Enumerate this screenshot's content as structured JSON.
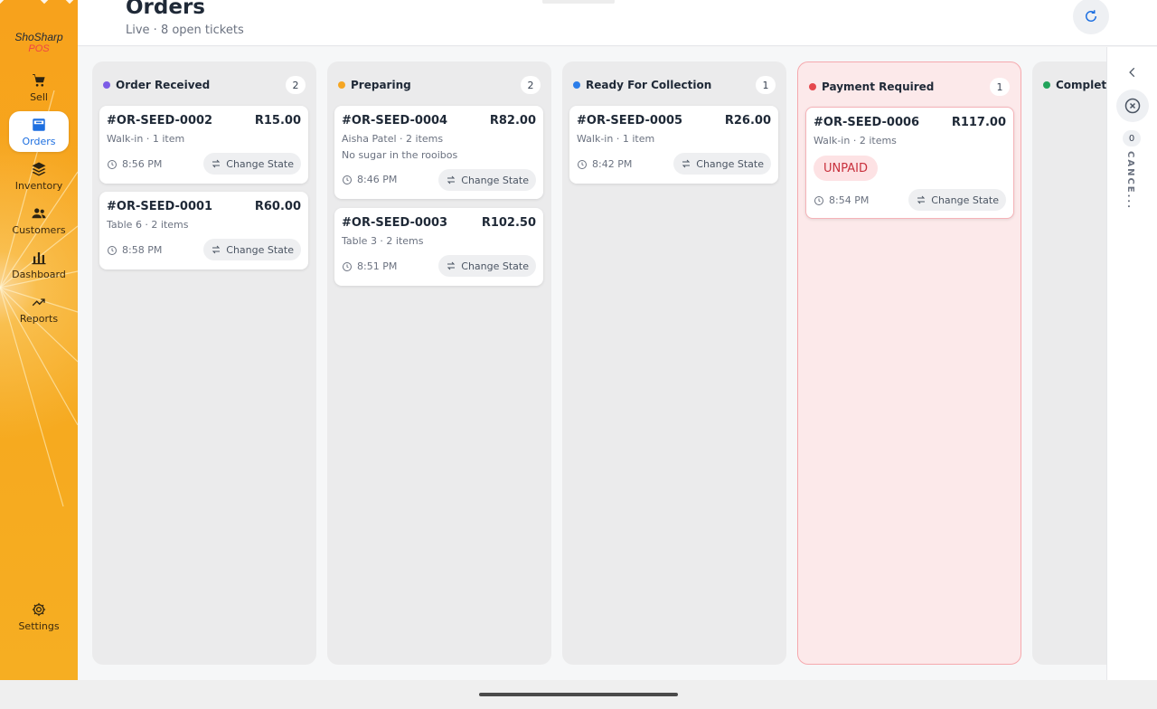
{
  "app": {
    "brand_name": "ShoSharp",
    "brand_sub": "POS"
  },
  "sidebar": {
    "items": [
      {
        "label": "Sell",
        "icon": "cart-icon"
      },
      {
        "label": "Orders",
        "icon": "orders-icon",
        "active": true
      },
      {
        "label": "Inventory",
        "icon": "layers-icon"
      },
      {
        "label": "Customers",
        "icon": "users-icon"
      },
      {
        "label": "Dashboard",
        "icon": "bar-chart-icon"
      },
      {
        "label": "Reports",
        "icon": "trend-icon"
      }
    ],
    "settings_label": "Settings"
  },
  "header": {
    "title": "Orders",
    "subtitle": "Live · 8 open tickets"
  },
  "board": {
    "change_state_label": "Change State",
    "columns": [
      {
        "title": "Order Received",
        "count": "2",
        "dot_color": "#7c5ce6",
        "cards": [
          {
            "id": "#OR-SEED-0002",
            "amount": "R15.00",
            "meta": "Walk-in · 1 item",
            "time": "8:56 PM"
          },
          {
            "id": "#OR-SEED-0001",
            "amount": "R60.00",
            "meta": "Table 6 · 2 items",
            "time": "8:58 PM"
          }
        ]
      },
      {
        "title": "Preparing",
        "count": "2",
        "dot_color": "#f5a623",
        "cards": [
          {
            "id": "#OR-SEED-0004",
            "amount": "R82.00",
            "meta": "Aisha Patel · 2 items",
            "note": "No sugar in the rooibos",
            "time": "8:46 PM"
          },
          {
            "id": "#OR-SEED-0003",
            "amount": "R102.50",
            "meta": "Table 3 · 2 items",
            "time": "8:51 PM"
          }
        ]
      },
      {
        "title": "Ready For Collection",
        "count": "1",
        "dot_color": "#2b7de9",
        "cards": [
          {
            "id": "#OR-SEED-0005",
            "amount": "R26.00",
            "meta": "Walk-in · 1 item",
            "time": "8:42 PM"
          }
        ]
      },
      {
        "title": "Payment Required",
        "count": "1",
        "dot_color": "#e5484d",
        "cards": [
          {
            "id": "#OR-SEED-0006",
            "amount": "R117.00",
            "meta": "Walk-in · 2 items",
            "badge": "UNPAID",
            "time": "8:54 PM"
          }
        ]
      },
      {
        "title": "Completed",
        "dot_color": "#22a35a"
      }
    ]
  },
  "drawer": {
    "count": "0",
    "label": "CANCE..."
  }
}
